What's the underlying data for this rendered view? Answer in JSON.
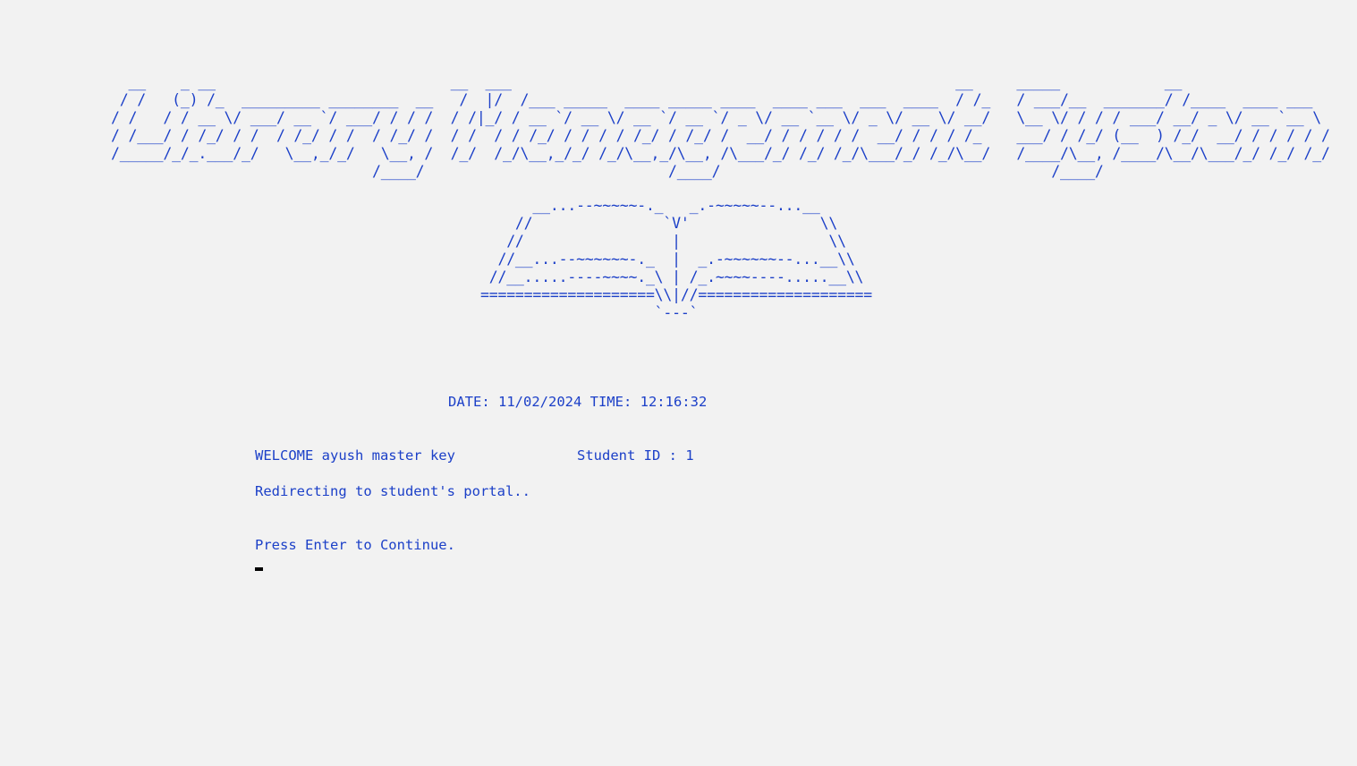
{
  "banner": {
    "art": "  __    _ __                           __  ___                                                   __     _____            __\n / /   (_) /_  _________ ________  __   /  |/  /___ _____  ____ _____ ____  ____ ___  ___  ____  / /_   / ___/__  _______/ /____  ____ ___\n/ /   / / __ \\/ ___/ __ `/ ___/ / / /  / /|_/ / __ `/ __ \\/ __ `/ __ `/ _ \\/ __ `__ \\/ _ \\/ __ \\/ __/   \\__ \\/ / / / ___/ __/ _ \\/ __ `__ \\\n/ /___/ / /_/ / /  / /_/ / /  / /_/ /  / /  / / /_/ / / / / /_/ / /_/ /  __/ / / / / /  __/ / / / /_    ___/ / /_/ (__  ) /_/  __/ / / / / /\n/_____/_/_.___/_/   \\__,_/_/   \\__, /  /_/  /_/\\__,_/_/ /_/\\__,_/\\__, /\\___/_/ /_/ /_/\\___/_/ /_/\\__/   /____/\\__, /____/\\__/\\___/_/ /_/ /_/\n                              /____/                            /____/                                      /____/"
  },
  "book": {
    "art": "      __...--~~~~~-._   _.-~~~~~--...__\n    //               `V'               \\\\\n   //                 |                 \\\\\n  //__...--~~~~~~-._  |  _.-~~~~~~--...__\\\\\n //__.....----~~~~._\\ | /_.~~~~----.....__\\\\\n====================\\\\|//====================\n                    `---`"
  },
  "session": {
    "datetime": "DATE: 11/02/2024 TIME: 12:16:32",
    "welcome": "WELCOME ayush master key",
    "student_id": "Student ID : 1",
    "redirect": "Redirecting to student's portal..",
    "continue_prompt": "Press Enter to Continue."
  },
  "colors": {
    "text": "#1c40c8",
    "background": "#f2f2f2",
    "cursor": "#000000"
  }
}
